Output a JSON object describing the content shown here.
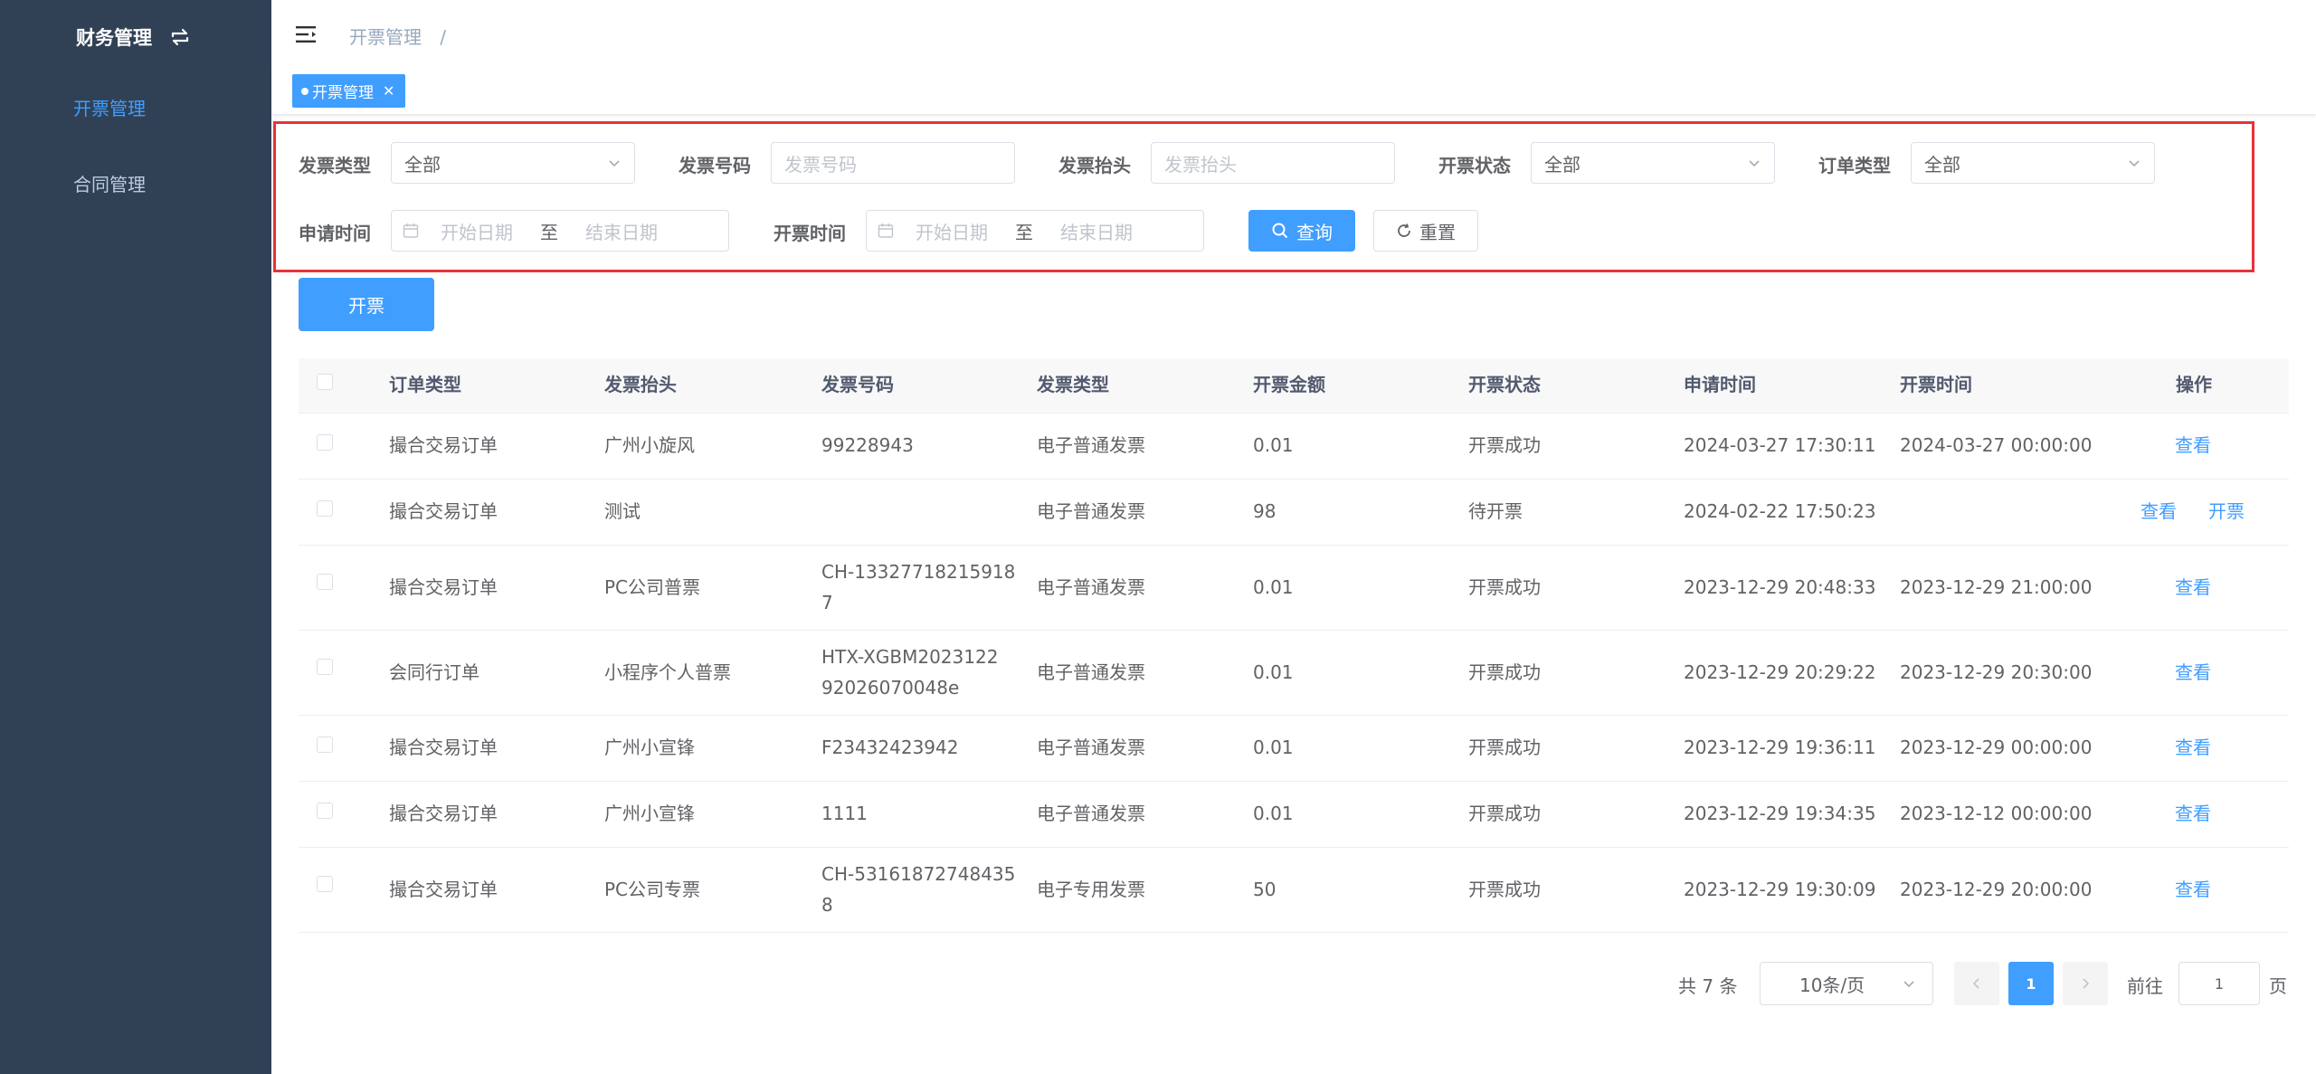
{
  "sidebar": {
    "title": "财务管理",
    "items": [
      {
        "label": "开票管理",
        "active": true
      },
      {
        "label": "合同管理",
        "active": false
      }
    ]
  },
  "header": {
    "breadcrumb": "开票管理",
    "breadcrumb_sep": "/"
  },
  "tags": [
    {
      "label": "开票管理"
    }
  ],
  "filters": {
    "invoice_type_label": "发票类型",
    "invoice_type_value": "全部",
    "invoice_no_label": "发票号码",
    "invoice_no_placeholder": "发票号码",
    "invoice_title_label": "发票抬头",
    "invoice_title_placeholder": "发票抬头",
    "status_label": "开票状态",
    "status_value": "全部",
    "order_type_label": "订单类型",
    "order_type_value": "全部",
    "apply_time_label": "申请时间",
    "issue_time_label": "开票时间",
    "start_placeholder": "开始日期",
    "range_sep": "至",
    "end_placeholder": "结束日期",
    "search_label": "查询",
    "reset_label": "重置"
  },
  "toolbar": {
    "issue_label": "开票"
  },
  "table": {
    "columns": [
      "订单类型",
      "发票抬头",
      "发票号码",
      "发票类型",
      "开票金额",
      "开票状态",
      "申请时间",
      "开票时间",
      "操作"
    ],
    "rows": [
      {
        "order_type": "撮合交易订单",
        "title": "广州小旋风",
        "no_line1": "99228943",
        "no_line2": "",
        "inv_type": "电子普通发票",
        "amount": "0.01",
        "status": "开票成功",
        "apply_time": "2024-03-27 17:30:11",
        "issue_time": "2024-03-27 00:00:00",
        "actions": [
          "查看"
        ]
      },
      {
        "order_type": "撮合交易订单",
        "title": "测试",
        "no_line1": "",
        "no_line2": "",
        "inv_type": "电子普通发票",
        "amount": "98",
        "status": "待开票",
        "apply_time": "2024-02-22 17:50:23",
        "issue_time": "",
        "actions": [
          "查看",
          "开票"
        ]
      },
      {
        "order_type": "撮合交易订单",
        "title": "PC公司普票",
        "no_line1": "CH-13327718215918",
        "no_line2": "7",
        "inv_type": "电子普通发票",
        "amount": "0.01",
        "status": "开票成功",
        "apply_time": "2023-12-29 20:48:33",
        "issue_time": "2023-12-29 21:00:00",
        "actions": [
          "查看"
        ]
      },
      {
        "order_type": "会同行订单",
        "title": "小程序个人普票",
        "no_line1": "HTX-XGBM2023122",
        "no_line2": "92026070048e",
        "inv_type": "电子普通发票",
        "amount": "0.01",
        "status": "开票成功",
        "apply_time": "2023-12-29 20:29:22",
        "issue_time": "2023-12-29 20:30:00",
        "actions": [
          "查看"
        ]
      },
      {
        "order_type": "撮合交易订单",
        "title": "广州小宣锋",
        "no_line1": "F23432423942",
        "no_line2": "",
        "inv_type": "电子普通发票",
        "amount": "0.01",
        "status": "开票成功",
        "apply_time": "2023-12-29 19:36:11",
        "issue_time": "2023-12-29 00:00:00",
        "actions": [
          "查看"
        ]
      },
      {
        "order_type": "撮合交易订单",
        "title": "广州小宣锋",
        "no_line1": "1111",
        "no_line2": "",
        "inv_type": "电子普通发票",
        "amount": "0.01",
        "status": "开票成功",
        "apply_time": "2023-12-29 19:34:35",
        "issue_time": "2023-12-12 00:00:00",
        "actions": [
          "查看"
        ]
      },
      {
        "order_type": "撮合交易订单",
        "title": "PC公司专票",
        "no_line1": "CH-53161872748435",
        "no_line2": "8",
        "inv_type": "电子专用发票",
        "amount": "50",
        "status": "开票成功",
        "apply_time": "2023-12-29 19:30:09",
        "issue_time": "2023-12-29 20:00:00",
        "actions": [
          "查看"
        ]
      }
    ]
  },
  "pagination": {
    "total": "共 7 条",
    "page_size": "10条/页",
    "current": "1",
    "goto_label": "前往",
    "goto_value": "1",
    "page_suffix": "页"
  },
  "colors": {
    "sidebar_bg": "#304156",
    "accent": "#409eff",
    "highlight": "#e8323a"
  },
  "icons": [
    "switch-icon",
    "hamburger-icon",
    "close-icon",
    "chevron-down-icon",
    "calendar-icon",
    "search-icon",
    "refresh-icon",
    "chevron-left-icon",
    "chevron-right-icon"
  ]
}
